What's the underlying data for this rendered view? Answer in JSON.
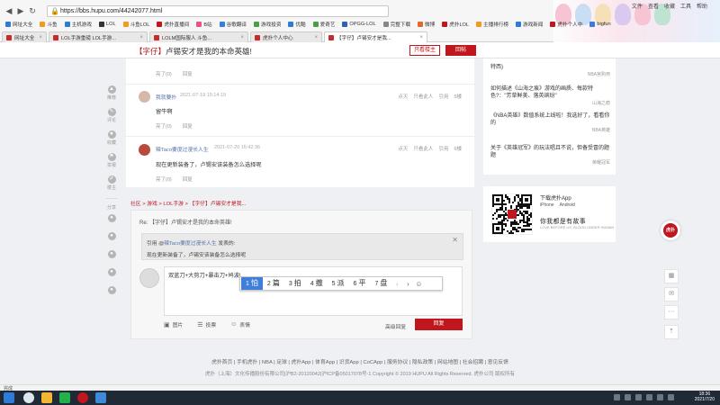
{
  "browser": {
    "url": "https://bbs.hupu.com/44242077.html",
    "menu": [
      "文件",
      "查看",
      "收藏",
      "工具",
      "帮助"
    ],
    "bookmarks": [
      {
        "label": "网址大全",
        "color": "#2f7bd6"
      },
      {
        "label": "斗鱼",
        "color": "#f29b1e"
      },
      {
        "label": "主机游戏",
        "color": "#2f7bd6"
      },
      {
        "label": "LOL",
        "color": "#333333"
      },
      {
        "label": "斗鱼LOL",
        "color": "#f29b1e"
      },
      {
        "label": "虎扑直播间",
        "color": "#c0161d"
      },
      {
        "label": "B站",
        "color": "#e7558b"
      },
      {
        "label": "谷歌翻译",
        "color": "#3a7de0"
      },
      {
        "label": "游戏投资",
        "color": "#4aa049"
      },
      {
        "label": "优酷",
        "color": "#2f7bd6"
      },
      {
        "label": "爱奇艺",
        "color": "#4aa049"
      },
      {
        "label": "OPGG-LOL",
        "color": "#2f5fb6"
      },
      {
        "label": "完整下载",
        "color": "#888888"
      },
      {
        "label": "微博",
        "color": "#e06a2a"
      },
      {
        "label": "虎扑LOL",
        "color": "#c0161d"
      },
      {
        "label": "主播排行榜",
        "color": "#f29b1e"
      },
      {
        "label": "游戏新闻",
        "color": "#2f7bd6"
      },
      {
        "label": "虎扑个人中",
        "color": "#c0161d"
      },
      {
        "label": "bigfun",
        "color": "#3a7de0"
      }
    ],
    "tabs": [
      {
        "label": "网址大全",
        "active": false
      },
      {
        "label": "LOL手游重磅 LOL手游...",
        "active": false
      },
      {
        "label": "LOLM国际服人 斗鱼...",
        "active": false
      },
      {
        "label": "虎扑个人中心",
        "active": false
      },
      {
        "label": "【字仔】卢锡安才是我...",
        "active": true
      }
    ]
  },
  "topbar": {
    "tag": "【字仔】",
    "title": "卢锡安才是我的本命英雄!",
    "view_op_label": "只看楼主",
    "reply_label": "回帖"
  },
  "left_rail": [
    {
      "icon": "up-icon",
      "label": "推荐",
      "badge": "0"
    },
    {
      "icon": "comment-icon",
      "label": "评论",
      "badge": "3"
    },
    {
      "icon": "star-icon",
      "label": "收藏",
      "badge": ""
    },
    {
      "icon": "flag-icon",
      "label": "举报",
      "badge": ""
    },
    {
      "icon": "pencil-icon",
      "label": "楼主",
      "badge": ""
    }
  ],
  "share_label": "分享",
  "posts": [
    {
      "user": "",
      "time": "",
      "text": "",
      "light": "亮了(0)",
      "reply": "回复",
      "meta": []
    },
    {
      "user": "我就要扑",
      "time": "2021-07-19 15:14:19",
      "text": "留牛啊",
      "light": "亮了(0)",
      "reply": "回复",
      "meta": [
        "点灭",
        "只看此人",
        "引用",
        "5楼"
      ]
    },
    {
      "user": "辣Taco要度过漫长人生",
      "time": "2021-07-20 15:42:36",
      "text": "现在更新装备了，卢锡安该装备怎么选择呢",
      "light": "亮了(0)",
      "reply": "回复",
      "meta": [
        "点灭",
        "只看此人",
        "引用",
        "6楼"
      ]
    }
  ],
  "breadcrumb": "社区 > 游戏 > LOL手游 > 【字仔】卢锡安才是我...",
  "reply_box": {
    "re_title": "Re: 【字仔】卢锡安才是我的本命英雄!",
    "quote_prefix": "引用 @",
    "quote_user": "辣Taco要度过漫长人生",
    "quote_suffix": " 发表的:",
    "quote_text": "现在更新装备了，卢锡安该装备怎么选择呢",
    "typed_text": "双蓝刀+大剪刀+暴击刀+鸠波|",
    "ime_candidates": [
      {
        "n": "1",
        "w": "怕"
      },
      {
        "n": "2",
        "w": "篇"
      },
      {
        "n": "3",
        "w": "拍"
      },
      {
        "n": "4",
        "w": "撒"
      },
      {
        "n": "5",
        "w": "派"
      },
      {
        "n": "6",
        "w": "平"
      },
      {
        "n": "7",
        "w": "盘"
      }
    ],
    "tool_image": "图片",
    "tool_vote": "投票",
    "tool_emoji": "表情",
    "advanced": "高级回复",
    "submit": "回复"
  },
  "sidebar_news": [
    {
      "title": "特西)",
      "source": "NBA宫购用"
    },
    {
      "title": "如何描述《山海之痕》游戏的画质、每款特色?：\"芳草鲜美、落英缤纷\"",
      "source": "山海之痕"
    },
    {
      "title": "《NBA英雄》数值系统上线啦！我选好了，看看你的",
      "source": "NBA英雄"
    },
    {
      "title": "关于《英雄冠军》的玩法唱且不说，但备受冒的题题",
      "source": "荣耀冠军"
    }
  ],
  "app_box": {
    "title": "下载虎扑App",
    "platforms": [
      "iPhone",
      "Android"
    ],
    "slogan": "你我都是有故事",
    "sub": "LOVE BEFORE US, BLOOD UNDER HUMAN"
  },
  "float_app_label": "虎扑",
  "footer": {
    "links": "虎扑首页 | 手机虎扑 | NBA | 足球 | 虎扑App | 体育App | 识货App | CoCApp | 服务协议 | 隐私政策 | 网站地图 | 社会招聘 | 意见反馈",
    "copyright": "虎扑（上海）文化传播股份有限公司|沪B2-20120042|沪ICP备05017078号-1 Copyright © 2019 HUPU All Rights Reserved. 虎扑公司 版权所有"
  },
  "status_text": "完成",
  "clock": {
    "time": "18:36",
    "date": "2021/7/20"
  },
  "colors": {
    "brand_red": "#c0161d",
    "link_blue": "#5572a8",
    "ime_highlight": "#3f7fd9"
  }
}
